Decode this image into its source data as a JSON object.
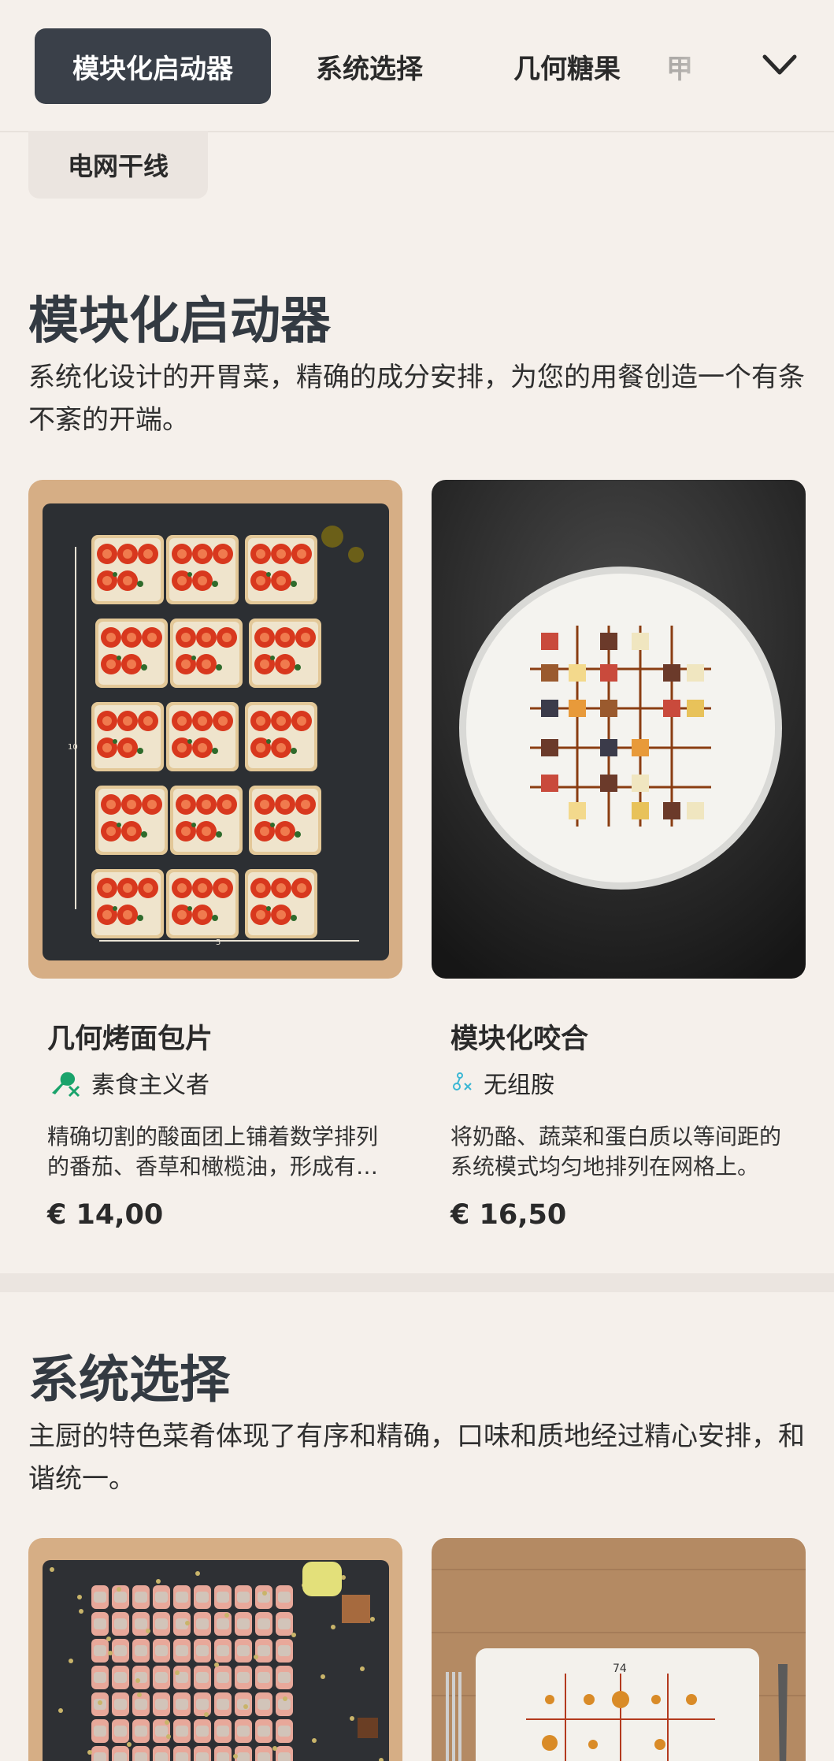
{
  "nav": {
    "tabs": [
      "模块化启动器",
      "系统选择",
      "几何糖果",
      "甲"
    ],
    "active_index": 0,
    "secondary_chip": "电网干线"
  },
  "sections": [
    {
      "title": "模块化启动器",
      "description": "系统化设计的开胃菜，精确的成分安排，为您的用餐创造一个有条不紊的开端。",
      "items": [
        {
          "name": "几何烤面包片",
          "diet_label": "素食主义者",
          "diet_icon": "vegetarian-drumstick-crossed-icon",
          "description": "精确切割的酸面团上铺着数学排列的番茄、香草和橄榄油，形成有序的网格。",
          "price": "€ 14,00",
          "image_icon": "bruschetta-grid-on-slate-image"
        },
        {
          "name": "模块化咬合",
          "diet_label": "无组胺",
          "diet_icon": "histamine-free-icon",
          "description": "将奶酪、蔬菜和蛋白质以等间距的系统模式均匀地排列在网格上。",
          "price": "€ 16,50",
          "image_icon": "modular-bites-on-white-plate-image"
        }
      ]
    },
    {
      "title": "系统选择",
      "description": "主厨的特色菜肴体现了有序和精确，口味和质地经过精心安排，和谐统一。",
      "items": [
        {
          "image_icon": "tuna-slices-grid-on-slate-image"
        },
        {
          "image_icon": "dots-grid-on-rectangular-plate-image",
          "plate_label": "74"
        }
      ]
    }
  ],
  "colors": {
    "background": "#f5f0eb",
    "active_tab": "#3a4049",
    "chip": "#ebe5e0",
    "vegetarian_icon": "#1aa36b",
    "histamine_icon": "#3bb7d4"
  }
}
